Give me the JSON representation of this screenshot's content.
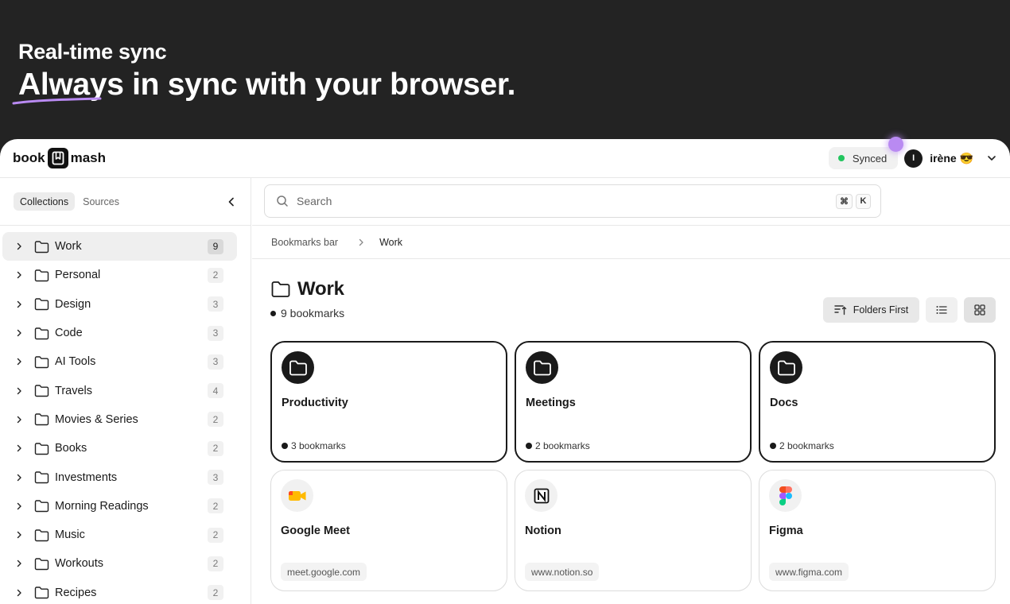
{
  "hero": {
    "eyebrow": "Real-time sync",
    "headline": "Always in sync with your browser."
  },
  "app": {
    "logo_left": "book",
    "logo_right": "mash"
  },
  "header": {
    "sync_status": "Synced",
    "user_initial": "I",
    "user_name": "irène 😎"
  },
  "sidebar": {
    "tabs": [
      {
        "label": "Collections",
        "active": true
      },
      {
        "label": "Sources",
        "active": false
      }
    ],
    "items": [
      {
        "label": "Work",
        "count": "9",
        "selected": true
      },
      {
        "label": "Personal",
        "count": "2"
      },
      {
        "label": "Design",
        "count": "3"
      },
      {
        "label": "Code",
        "count": "3"
      },
      {
        "label": "AI Tools",
        "count": "3"
      },
      {
        "label": "Travels",
        "count": "4"
      },
      {
        "label": "Movies & Series",
        "count": "2"
      },
      {
        "label": "Books",
        "count": "2"
      },
      {
        "label": "Investments",
        "count": "3"
      },
      {
        "label": "Morning Readings",
        "count": "2"
      },
      {
        "label": "Music",
        "count": "2"
      },
      {
        "label": "Workouts",
        "count": "2"
      },
      {
        "label": "Recipes",
        "count": "2"
      }
    ]
  },
  "search": {
    "placeholder": "Search",
    "shortcut_mod": "⌘",
    "shortcut_key": "K"
  },
  "breadcrumb": {
    "root": "Bookmarks bar",
    "current": "Work"
  },
  "collection": {
    "title": "Work",
    "count_label": "9 bookmarks"
  },
  "toolbar": {
    "sort_label": "Folders First"
  },
  "cards": [
    {
      "type": "folder",
      "name": "Productivity",
      "meta": "3 bookmarks"
    },
    {
      "type": "folder",
      "name": "Meetings",
      "meta": "2 bookmarks"
    },
    {
      "type": "folder",
      "name": "Docs",
      "meta": "2 bookmarks"
    },
    {
      "type": "link",
      "name": "Google Meet",
      "meta": "meet.google.com",
      "icon": "google-meet-icon"
    },
    {
      "type": "link",
      "name": "Notion",
      "meta": "www.notion.so",
      "icon": "notion-icon"
    },
    {
      "type": "link",
      "name": "Figma",
      "meta": "www.figma.com",
      "icon": "figma-icon"
    }
  ],
  "colors": {
    "accent": "#b98af2",
    "synced_dot": "#22c55e",
    "hero_bg": "#232323"
  }
}
